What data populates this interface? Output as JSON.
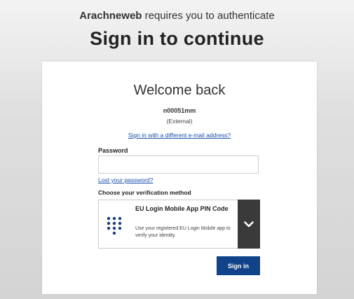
{
  "header": {
    "app_name": "Arachneweb",
    "requires_text": " requires you to authenticate",
    "title": "Sign in to continue"
  },
  "card": {
    "welcome": "Welcome back",
    "username": "n00051mm",
    "user_type": "(External)",
    "different_email_link": "Sign in with a different e-mail address?",
    "password_label": "Password",
    "password_value": "",
    "lost_password_link": "Lost your password?",
    "verification_label": "Choose your verification method",
    "method": {
      "title": "EU Login Mobile App PIN Code",
      "description": "Use your registered EU Login Mobile app to verify your identity.",
      "icon": "keypad-icon",
      "toggle_icon": "chevron-down-icon"
    },
    "signin_label": "Sign in"
  },
  "colors": {
    "primary_button": "#10438a",
    "link": "#1a4fa8",
    "toggle_bg": "#3a3a3a",
    "keypad": "#1b3f82"
  }
}
